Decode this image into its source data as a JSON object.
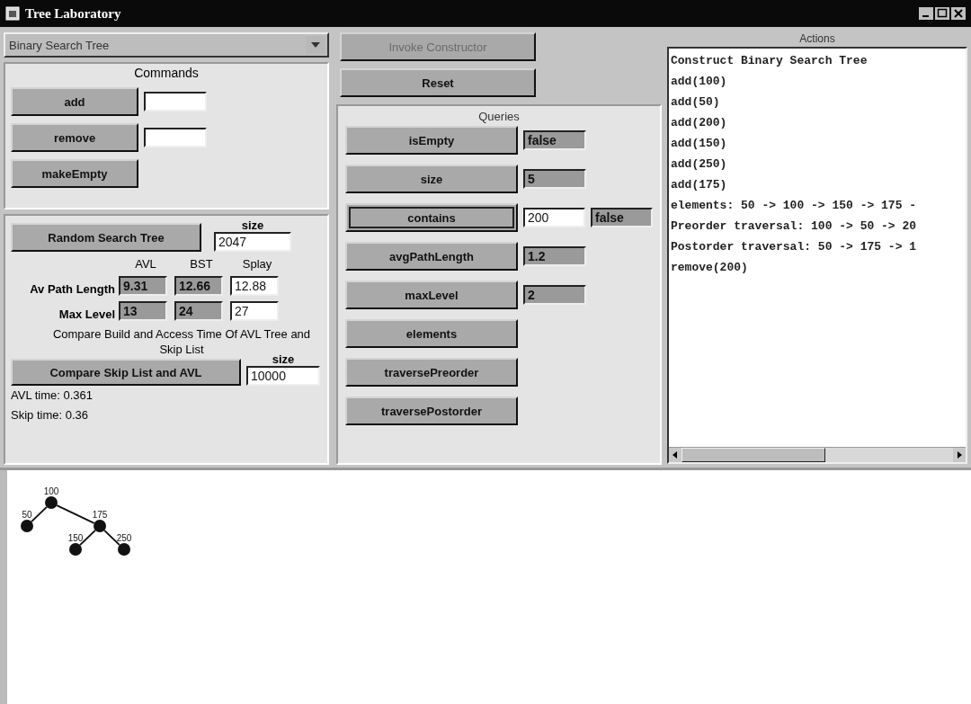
{
  "window": {
    "title": "Tree Laboratory"
  },
  "tree_type": {
    "value": "Binary Search Tree"
  },
  "commands": {
    "title": "Commands",
    "rows": [
      {
        "button": "add",
        "kind": "with_field"
      },
      {
        "button": "remove",
        "kind": "with_field"
      },
      {
        "button": "makeEmpty",
        "kind": "plain"
      }
    ]
  },
  "random_tree": {
    "button": "Random Search Tree",
    "size_label": "size",
    "size": "2047",
    "columns": [
      "AVL",
      "BST",
      "Splay"
    ],
    "rows": [
      {
        "label": "Av Path Length",
        "cells": [
          {
            "value": "9.31",
            "editable": false
          },
          {
            "value": "12.66",
            "editable": false
          },
          {
            "value": "12.88",
            "editable": true
          }
        ]
      },
      {
        "label": "Max Level",
        "cells": [
          {
            "value": "13",
            "editable": false
          },
          {
            "value": "24",
            "editable": false
          },
          {
            "value": "27",
            "editable": true
          }
        ]
      }
    ]
  },
  "compare": {
    "caption": "Compare Build and Access Time Of AVL Tree and Skip List",
    "button": "Compare Skip List and AVL",
    "size_label": "size",
    "size": "10000",
    "results": [
      "AVL time: 0.361",
      "Skip time: 0.36"
    ]
  },
  "top_buttons": [
    {
      "label": "Invoke Constructor",
      "disabled": true
    },
    {
      "label": "Reset",
      "disabled": false
    }
  ],
  "queries": {
    "title": "Queries",
    "rows": [
      {
        "button": "isEmpty",
        "focused": false,
        "fields": [
          {
            "value": "false",
            "editable": false
          }
        ]
      },
      {
        "button": "size",
        "focused": false,
        "fields": [
          {
            "value": "5",
            "editable": false
          }
        ]
      },
      {
        "button": "contains",
        "focused": true,
        "fields": [
          {
            "value": "200",
            "editable": true
          },
          {
            "value": "false",
            "editable": false
          }
        ]
      },
      {
        "button": "avgPathLength",
        "focused": false,
        "fields": [
          {
            "value": "1.2",
            "editable": false
          }
        ]
      },
      {
        "button": "maxLevel",
        "focused": false,
        "fields": [
          {
            "value": "2",
            "editable": false
          }
        ]
      },
      {
        "button": "elements",
        "focused": false
      },
      {
        "button": "traversePreorder",
        "focused": false
      },
      {
        "button": "traversePostorder",
        "focused": false
      }
    ]
  },
  "actions": {
    "title": "Actions",
    "lines": [
      "Construct Binary Search Tree",
      "add(100)",
      "add(50)",
      "add(200)",
      "add(150)",
      "add(250)",
      "add(175)",
      "elements: 50 -> 100 -> 150 -> 175 -",
      "Preorder traversal: 100 -> 50 -> 20",
      "Postorder traversal: 50 -> 175 -> 1",
      "remove(200)"
    ]
  },
  "tree_view": {
    "root": {
      "label": "100",
      "children": [
        {
          "label": "50"
        },
        {
          "label": "175",
          "children": [
            {
              "label": "150"
            },
            {
              "label": "250"
            }
          ]
        }
      ]
    }
  }
}
